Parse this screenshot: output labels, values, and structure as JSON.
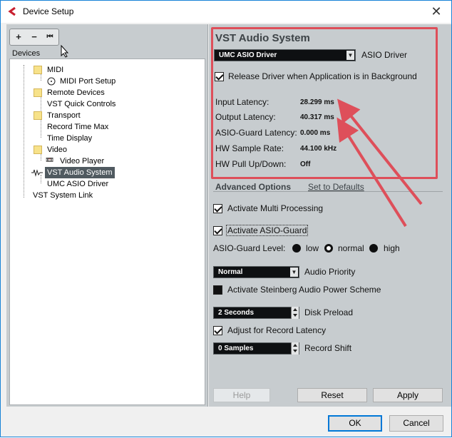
{
  "window": {
    "title": "Device Setup"
  },
  "left_panel": {
    "toolbar": {
      "add": "+",
      "remove": "−",
      "reset": "⏮"
    },
    "devices_label": "Devices",
    "tree": [
      {
        "label": "MIDI"
      },
      {
        "label": "MIDI Port Setup"
      },
      {
        "label": "Remote Devices"
      },
      {
        "label": "VST Quick Controls"
      },
      {
        "label": "Transport"
      },
      {
        "label": "Record Time Max"
      },
      {
        "label": "Time Display"
      },
      {
        "label": "Video"
      },
      {
        "label": "Video Player"
      },
      {
        "label": "VST Audio System"
      },
      {
        "label": "UMC ASIO Driver"
      },
      {
        "label": "VST System Link"
      }
    ]
  },
  "vst": {
    "title": "VST Audio System",
    "driver_value": "UMC ASIO Driver",
    "driver_label": "ASIO Driver",
    "release_label": "Release Driver when Application is in Background",
    "stats": [
      {
        "label": "Input Latency:",
        "value": "28.299 ms"
      },
      {
        "label": "Output Latency:",
        "value": "40.317 ms"
      },
      {
        "label": "ASIO-Guard Latency:",
        "value": "0.000 ms"
      },
      {
        "label": "HW Sample Rate:",
        "value": "44.100 kHz"
      },
      {
        "label": "HW Pull Up/Down:",
        "value": "Off"
      }
    ]
  },
  "advanced": {
    "title": "Advanced Options",
    "defaults_link": "Set to Defaults",
    "multi_processing": "Activate Multi Processing",
    "asio_guard": "Activate ASIO-Guard",
    "asio_guard_level_label": "ASIO-Guard Level:",
    "levels": [
      "low",
      "normal",
      "high"
    ],
    "priority_value": "Normal",
    "priority_label": "Audio Priority",
    "power_scheme": "Activate Steinberg Audio Power Scheme",
    "preload_value": "2 Seconds",
    "preload_label": "Disk Preload",
    "adjust_latency": "Adjust for Record Latency",
    "shift_value": "0 Samples",
    "shift_label": "Record Shift"
  },
  "buttons": {
    "help": "Help",
    "reset": "Reset",
    "apply": "Apply",
    "ok": "OK",
    "cancel": "Cancel"
  },
  "colors": {
    "highlight_box": "#de4f5a",
    "panel": "#c7cccf",
    "selection": "#505a60"
  }
}
